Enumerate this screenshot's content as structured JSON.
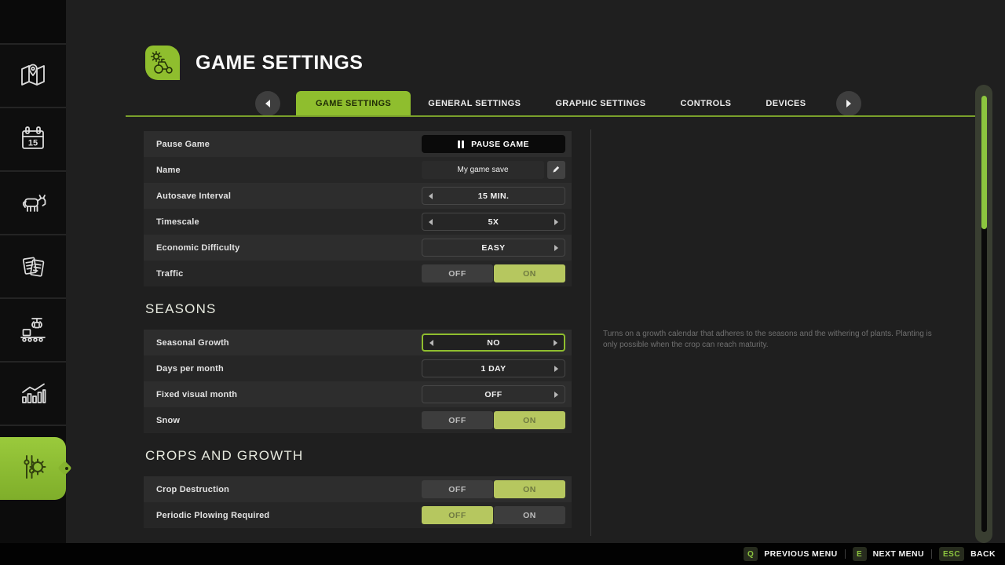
{
  "header": {
    "title": "GAME SETTINGS",
    "icon": "tractor-settings-icon"
  },
  "tab_bar": {
    "back_icon": "chevron-left-icon",
    "forward_icon": "chevron-right-icon",
    "tabs": [
      {
        "label": "GAME SETTINGS",
        "active": true
      },
      {
        "label": "GENERAL SETTINGS",
        "active": false
      },
      {
        "label": "GRAPHIC SETTINGS",
        "active": false
      },
      {
        "label": "CONTROLS",
        "active": false
      },
      {
        "label": "DEVICES",
        "active": false
      }
    ]
  },
  "sidebar": {
    "items": [
      {
        "icon": "map-icon",
        "active": false
      },
      {
        "icon": "calendar-icon",
        "badge": "15",
        "active": false
      },
      {
        "icon": "animals-icon",
        "active": false
      },
      {
        "icon": "contracts-icon",
        "active": false
      },
      {
        "icon": "production-icon",
        "active": false
      },
      {
        "icon": "statistics-icon",
        "active": false
      },
      {
        "icon": "settings-icon",
        "active": true
      }
    ]
  },
  "settings_sections": [
    {
      "title": "",
      "rows": [
        {
          "label": "Pause Game",
          "control": {
            "type": "button",
            "label": "PAUSE GAME",
            "icon": "pause-icon"
          }
        },
        {
          "label": "Name",
          "control": {
            "type": "text",
            "value": "My game save",
            "edit_icon": "pencil-icon"
          }
        },
        {
          "label": "Autosave Interval",
          "control": {
            "type": "selector",
            "value": "15 MIN.",
            "left_arrow": true,
            "right_arrow": false,
            "focused": false
          }
        },
        {
          "label": "Timescale",
          "control": {
            "type": "selector",
            "value": "5X",
            "left_arrow": true,
            "right_arrow": true,
            "focused": false
          }
        },
        {
          "label": "Economic Difficulty",
          "control": {
            "type": "selector",
            "value": "EASY",
            "left_arrow": false,
            "right_arrow": true,
            "focused": false
          }
        },
        {
          "label": "Traffic",
          "control": {
            "type": "toggle",
            "off_label": "OFF",
            "on_label": "ON",
            "value": "ON"
          }
        }
      ]
    },
    {
      "title": "SEASONS",
      "rows": [
        {
          "label": "Seasonal Growth",
          "control": {
            "type": "selector",
            "value": "NO",
            "left_arrow": true,
            "right_arrow": true,
            "focused": true
          }
        },
        {
          "label": "Days per month",
          "control": {
            "type": "selector",
            "value": "1 DAY",
            "left_arrow": false,
            "right_arrow": true,
            "focused": false
          }
        },
        {
          "label": "Fixed visual month",
          "control": {
            "type": "selector",
            "value": "OFF",
            "left_arrow": false,
            "right_arrow": true,
            "focused": false
          }
        },
        {
          "label": "Snow",
          "control": {
            "type": "toggle",
            "off_label": "OFF",
            "on_label": "ON",
            "value": "ON"
          }
        }
      ]
    },
    {
      "title": "CROPS AND GROWTH",
      "rows": [
        {
          "label": "Crop Destruction",
          "control": {
            "type": "toggle",
            "off_label": "OFF",
            "on_label": "ON",
            "value": "ON"
          }
        },
        {
          "label": "Periodic Plowing Required",
          "control": {
            "type": "toggle",
            "off_label": "OFF",
            "on_label": "ON",
            "value": "OFF"
          }
        }
      ]
    }
  ],
  "info_panel": {
    "text": "Turns on a growth calendar that adheres to the seasons and the withering of plants. Planting is only possible when the crop can reach maturity."
  },
  "footer": {
    "hints": [
      {
        "key": "Q",
        "label": "PREVIOUS MENU"
      },
      {
        "key": "E",
        "label": "NEXT MENU"
      },
      {
        "key": "ESC",
        "label": "BACK"
      }
    ]
  },
  "colors": {
    "accent_green": "#8fbe2e",
    "toggle_green": "#b6c75f",
    "toggle_green_text": "#6f7a41",
    "row_light": "#2d2d2d",
    "row_dark": "#262626",
    "panel_bg": "#1f1f1f",
    "sidebar_bg": "#0c0c0c",
    "footer_bg": "#020202",
    "scrollbar_thumb": "#8dc63f"
  }
}
